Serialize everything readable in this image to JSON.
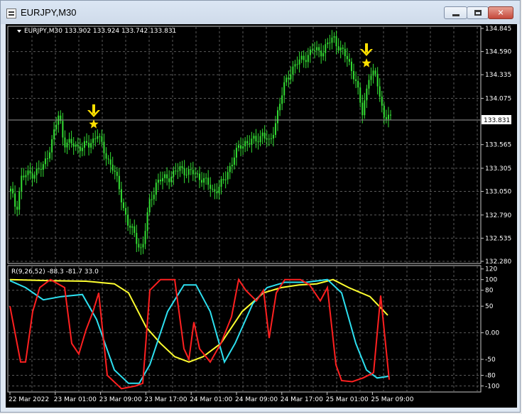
{
  "window": {
    "title": "EURJPY,M30"
  },
  "main_pane": {
    "header": "EURJPY,M30  133.902 133.924 133.742 133.831",
    "current_price": "133.831",
    "price_ticks": [
      "134.845",
      "134.590",
      "134.335",
      "134.075",
      "133.565",
      "133.305",
      "133.050",
      "132.790",
      "132.535",
      "132.280"
    ],
    "signals": [
      {
        "time_label": "23 Mar 01:00",
        "type": "sell-arrow-star"
      },
      {
        "time_label": "25 Mar 09:00",
        "type": "sell-arrow-star"
      }
    ]
  },
  "indicator_pane": {
    "header": "R(9,26,52) -88.3 -81.7 33.0",
    "ticks": [
      "120",
      "100",
      "80",
      "50",
      "0.00",
      "-50",
      "-80",
      "-100"
    ],
    "series": [
      {
        "values": [
          -88.3
        ],
        "color": "#ff2020"
      },
      {
        "values": [
          -81.7
        ],
        "color": "#2de0f0"
      },
      {
        "values": [
          33.0
        ],
        "color": "#ffff30"
      }
    ]
  },
  "time_axis": [
    "22 Mar 2022",
    "23 Mar 01:00",
    "23 Mar 09:00",
    "23 Mar 17:00",
    "24 Mar 01:00",
    "24 Mar 09:00",
    "24 Mar 17:00",
    "25 Mar 01:00",
    "25 Mar 09:00"
  ],
  "chart_data": [
    {
      "type": "line",
      "title": "EURJPY,M30",
      "description_source": "candlestick close approximation",
      "x": [
        "22 Mar 2022",
        "23 Mar 01:00",
        "23 Mar 09:00",
        "23 Mar 17:00",
        "24 Mar 01:00",
        "24 Mar 09:00",
        "24 Mar 17:00",
        "25 Mar 01:00",
        "25 Mar 09:00"
      ],
      "series": [
        {
          "values": [
            133.0,
            133.4,
            132.4,
            133.3,
            133.2,
            133.6,
            134.6,
            134.7,
            133.83
          ]
        }
      ],
      "ylim": [
        132.28,
        134.845
      ]
    },
    {
      "type": "line",
      "title": "R(9,26,52)",
      "series": [
        {
          "color": "#ff2020",
          "values": [
            55,
            65,
            80,
            -95,
            -85,
            -60,
            -70,
            95,
            100,
            -85,
            -88.3
          ]
        },
        {
          "color": "#2de0f0",
          "values": [
            90,
            60,
            70,
            -90,
            85,
            -40,
            10,
            85,
            95,
            -70,
            -81.7
          ]
        },
        {
          "color": "#ffff30",
          "values": [
            95,
            93,
            90,
            -15,
            -55,
            -20,
            70,
            85,
            95,
            70,
            33.0
          ]
        }
      ],
      "ylim": [
        -100,
        120
      ]
    }
  ]
}
